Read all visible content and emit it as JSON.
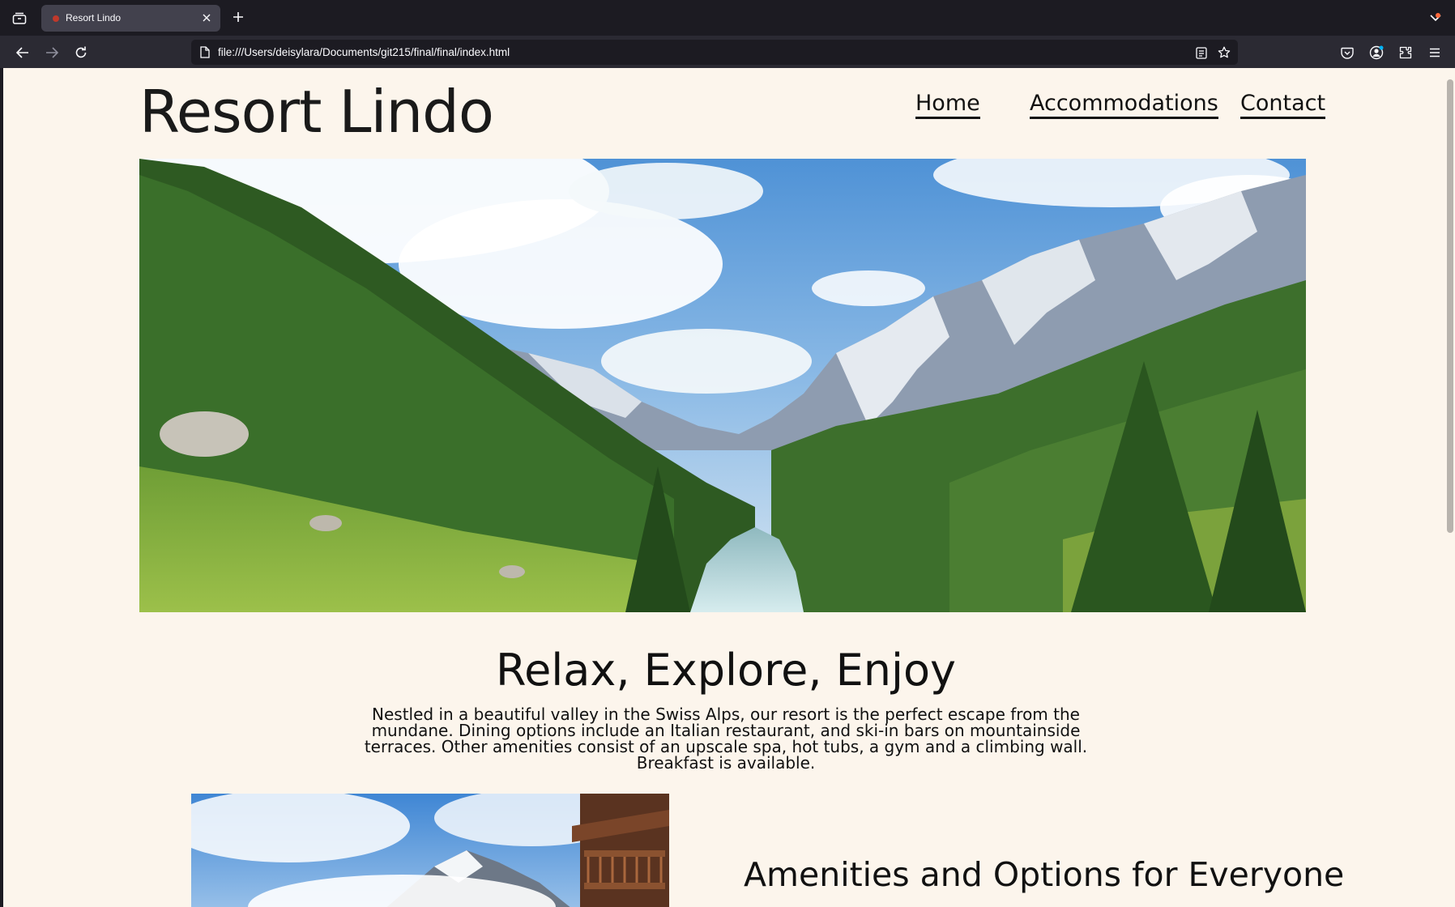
{
  "browser": {
    "tab_title": "Resort Lindo",
    "url": "file:///Users/deisylara/Documents/git215/final/final/index.html",
    "icons": [
      "tab-list-icon",
      "close-icon",
      "plus-icon",
      "chevron-down-icon",
      "back-arrow-icon",
      "forward-arrow-icon",
      "reload-icon",
      "page-icon",
      "reader-view-icon",
      "star-icon",
      "pocket-icon",
      "account-icon",
      "extensions-icon",
      "menu-icon"
    ],
    "colors": {
      "chrome_bg": "#1c1b22",
      "toolbar_bg": "#2b2a33",
      "tab_active": "#42414d"
    }
  },
  "site": {
    "title": "Resort Lindo",
    "nav": [
      {
        "label": "Home"
      },
      {
        "label": "Accommodations"
      },
      {
        "label": "Contact"
      }
    ],
    "hero_alt": "Swiss Alps valley with forests and river",
    "heading": "Relax, Explore, Enjoy",
    "intro": "Nestled in a beautiful valley in the Swiss Alps, our resort is the perfect escape from the mundane. Dining options include an Italian restaurant, and ski-in bars on mountainside terraces. Other amenities consist of an upscale spa, hot tubs, a gym and a climbing wall. Breakfast is available.",
    "amenities_heading": "Amenities and Options for Everyone",
    "colors": {
      "page_bg": "#fcf5ec",
      "text": "#111111"
    }
  }
}
